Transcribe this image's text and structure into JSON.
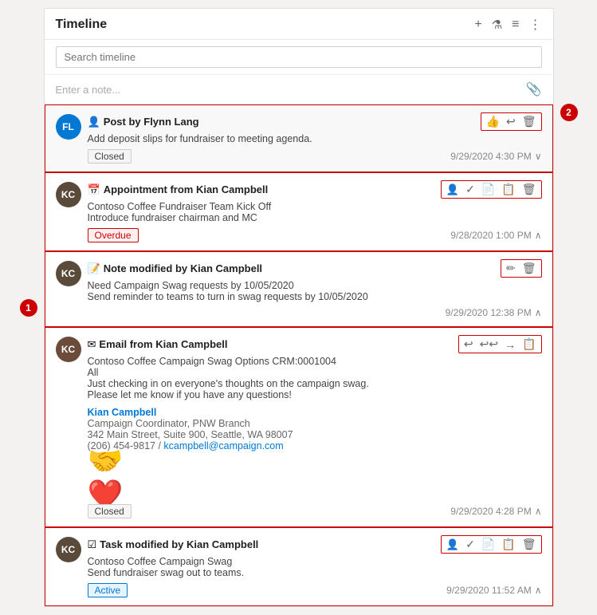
{
  "header": {
    "title": "Timeline",
    "search_placeholder": "Search timeline",
    "note_placeholder": "Enter a note...",
    "icons": {
      "add": "+",
      "filter": "⊘",
      "sort": "≡",
      "more": "⋮",
      "paperclip": "📎"
    }
  },
  "items": [
    {
      "id": "post-1",
      "avatar_initials": "FL",
      "avatar_class": "avatar-fl",
      "type_icon": "👤",
      "type_label": "Post",
      "title": "Post by Flynn Lang",
      "body": "Add deposit slips for fundraiser to meeting agenda.",
      "badge": "Closed",
      "badge_type": "closed",
      "timestamp": "9/29/2020 4:30 PM",
      "actions": [
        "👍",
        "↩",
        "🗑"
      ]
    },
    {
      "id": "appointment-1",
      "avatar_initials": "KC",
      "avatar_class": "avatar-kc-dark",
      "type_icon": "📅",
      "type_label": "Appointment",
      "title": "Appointment from Kian Campbell",
      "body": "Contoso Coffee Fundraiser Team Kick Off\nIntroduce fundraiser chairman and MC",
      "badge": "Overdue",
      "badge_type": "overdue",
      "timestamp": "9/28/2020 1:00 PM",
      "actions": [
        "👤",
        "✓",
        "📄",
        "📋",
        "🗑"
      ]
    },
    {
      "id": "note-1",
      "avatar_initials": "KC",
      "avatar_class": "avatar-kc-dark",
      "type_icon": "📝",
      "type_label": "Note",
      "title": "Note modified by Kian Campbell",
      "body": "Need Campaign Swag requests by 10/05/2020\nSend reminder to teams to turn in swag requests by 10/05/2020",
      "badge": null,
      "timestamp": "9/29/2020 12:38 PM",
      "actions": [
        "✏",
        "🗑"
      ]
    },
    {
      "id": "email-1",
      "avatar_initials": "KC",
      "avatar_class": "avatar-kc-brown",
      "type_icon": "✉",
      "type_label": "Email",
      "title": "Email from Kian Campbell",
      "body": "Contoso Coffee Campaign Swag Options CRM:0001004\nAll\nJust checking in on everyone's thoughts on the campaign swag.\nPlease let me know if you have any questions!",
      "signature": {
        "name": "Kian Campbell",
        "role": "Campaign Coordinator, PNW Branch",
        "address": "342 Main Street, Suite 900, Seattle, WA 98007",
        "phone": "(206) 454-9817",
        "email": "kcampbell@campaign.com"
      },
      "has_image": true,
      "badge": "Closed",
      "badge_type": "closed",
      "timestamp": "9/29/2020 4:28 PM",
      "actions": [
        "↩",
        "↩↩",
        "→",
        "📋"
      ]
    },
    {
      "id": "task-1",
      "avatar_initials": "KC",
      "avatar_class": "avatar-kc-dark",
      "type_icon": "☑",
      "type_label": "Task",
      "title": "Task modified by Kian Campbell",
      "body": "Contoso Coffee Campaign Swag\nSend fundraiser swag out to teams.",
      "badge": "Active",
      "badge_type": "active",
      "timestamp": "9/29/2020 11:52 AM",
      "actions": [
        "👤",
        "✓",
        "📄",
        "📋",
        "🗑"
      ]
    }
  ],
  "markers": {
    "m1": "1",
    "m2": "2"
  }
}
